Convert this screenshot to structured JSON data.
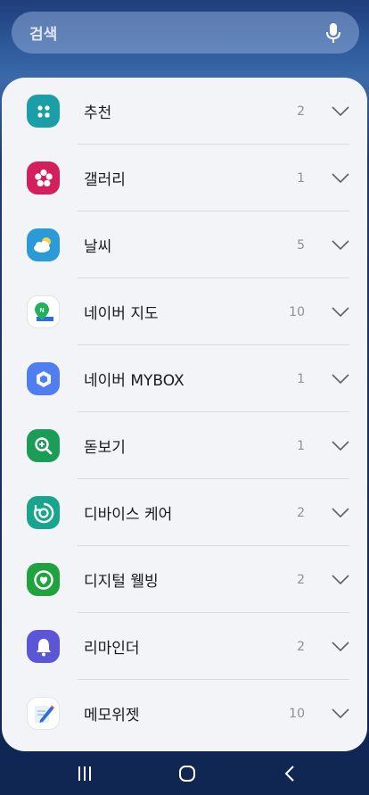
{
  "search": {
    "placeholder": "검색",
    "icon": "mic-icon"
  },
  "apps": [
    {
      "label": "추천",
      "count": "2",
      "icon": "recommend-icon",
      "color": "#1a9ea8"
    },
    {
      "label": "갤러리",
      "count": "1",
      "icon": "gallery-flower-icon",
      "color": "#d31f5b"
    },
    {
      "label": "날씨",
      "count": "5",
      "icon": "weather-icon",
      "color": "#2a9ad8"
    },
    {
      "label": "네이버 지도",
      "count": "10",
      "icon": "naver-map-icon",
      "color": "#ffffff"
    },
    {
      "label": "네이버 MYBOX",
      "count": "1",
      "icon": "mybox-icon",
      "color": "#4f7ef0"
    },
    {
      "label": "돋보기",
      "count": "1",
      "icon": "magnifier-icon",
      "color": "#1a9e57"
    },
    {
      "label": "디바이스 케어",
      "count": "2",
      "icon": "device-care-icon",
      "color": "#19a58d"
    },
    {
      "label": "디지털 웰빙",
      "count": "2",
      "icon": "digital-wellbeing-icon",
      "color": "#1fa33e"
    },
    {
      "label": "리마인더",
      "count": "2",
      "icon": "reminder-bell-icon",
      "color": "#5b56d8"
    },
    {
      "label": "메모위젯",
      "count": "10",
      "icon": "memo-widget-icon",
      "color": "#ffffff"
    }
  ],
  "nav": {
    "recents": "recents-icon",
    "home": "home-icon",
    "back": "back-icon"
  }
}
